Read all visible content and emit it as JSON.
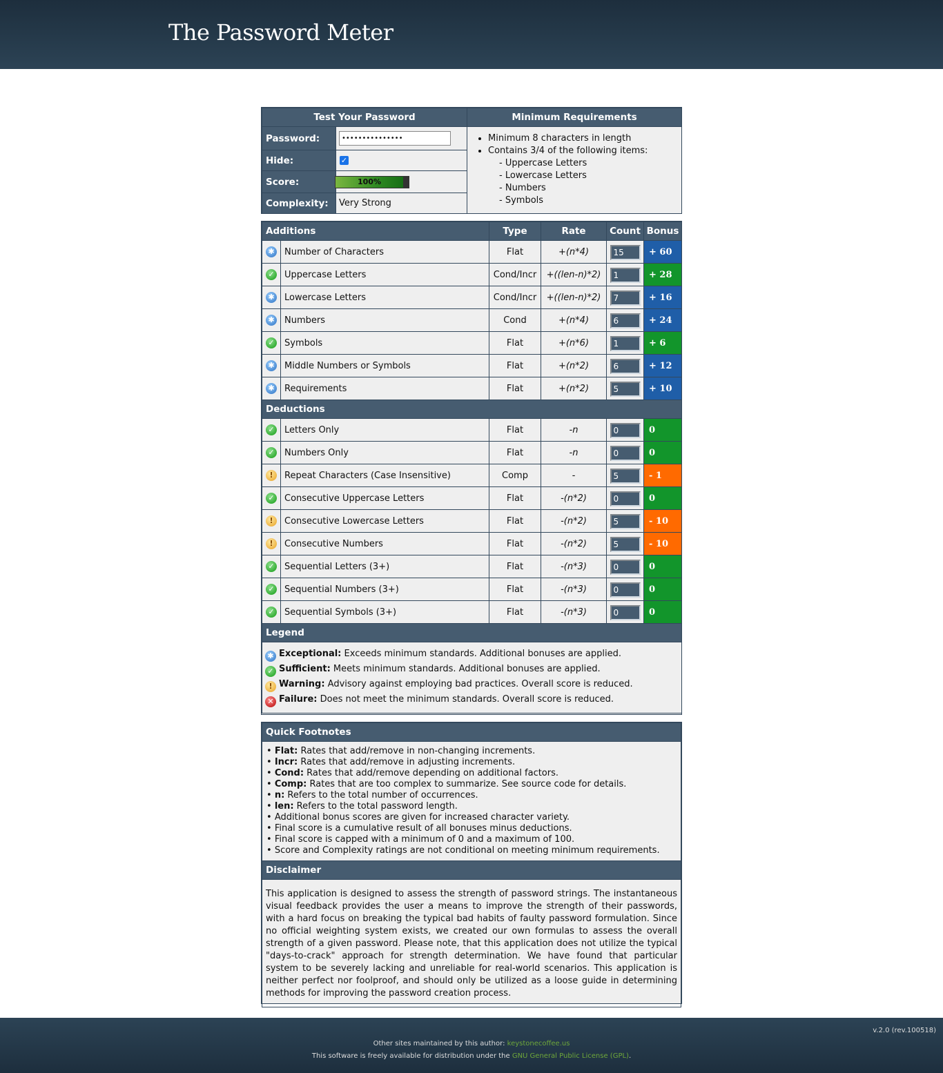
{
  "header": {
    "title": "The Password Meter"
  },
  "test": {
    "title": "Test Your Password",
    "password_label": "Password:",
    "password_value": "•••••••••••••••",
    "hide_label": "Hide:",
    "hide_checked": true,
    "score_label": "Score:",
    "score_text": "100%",
    "score_fraction": 1.0,
    "complexity_label": "Complexity:",
    "complexity_value": "Very Strong"
  },
  "requirements": {
    "title": "Minimum Requirements",
    "items": [
      "Minimum 8 characters in length",
      "Contains 3/4 of the following items:"
    ],
    "subitems": [
      "- Uppercase Letters",
      "- Lowercase Letters",
      "- Numbers",
      "- Symbols"
    ]
  },
  "columns": {
    "additions": "Additions",
    "type": "Type",
    "rate": "Rate",
    "count": "Count",
    "bonus": "Bonus"
  },
  "additions": [
    {
      "status": "exceptional",
      "name": "Number of Characters",
      "type": "Flat",
      "rate": "+(n*4)",
      "count": "15",
      "bonus": "+ 60"
    },
    {
      "status": "sufficient",
      "name": "Uppercase Letters",
      "type": "Cond/Incr",
      "rate": "+((len-n)*2)",
      "count": "1",
      "bonus": "+ 28"
    },
    {
      "status": "exceptional",
      "name": "Lowercase Letters",
      "type": "Cond/Incr",
      "rate": "+((len-n)*2)",
      "count": "7",
      "bonus": "+ 16"
    },
    {
      "status": "exceptional",
      "name": "Numbers",
      "type": "Cond",
      "rate": "+(n*4)",
      "count": "6",
      "bonus": "+ 24"
    },
    {
      "status": "sufficient",
      "name": "Symbols",
      "type": "Flat",
      "rate": "+(n*6)",
      "count": "1",
      "bonus": "+ 6"
    },
    {
      "status": "exceptional",
      "name": "Middle Numbers or Symbols",
      "type": "Flat",
      "rate": "+(n*2)",
      "count": "6",
      "bonus": "+ 12"
    },
    {
      "status": "exceptional",
      "name": "Requirements",
      "type": "Flat",
      "rate": "+(n*2)",
      "count": "5",
      "bonus": "+ 10"
    }
  ],
  "deductions_title": "Deductions",
  "deductions": [
    {
      "status": "sufficient",
      "name": "Letters Only",
      "type": "Flat",
      "rate": "-n",
      "count": "0",
      "bonus": "0"
    },
    {
      "status": "sufficient",
      "name": "Numbers Only",
      "type": "Flat",
      "rate": "-n",
      "count": "0",
      "bonus": "0"
    },
    {
      "status": "warning",
      "name": "Repeat Characters (Case Insensitive)",
      "type": "Comp",
      "rate": "-",
      "count": "5",
      "bonus": "- 1"
    },
    {
      "status": "sufficient",
      "name": "Consecutive Uppercase Letters",
      "type": "Flat",
      "rate": "-(n*2)",
      "count": "0",
      "bonus": "0"
    },
    {
      "status": "warning",
      "name": "Consecutive Lowercase Letters",
      "type": "Flat",
      "rate": "-(n*2)",
      "count": "5",
      "bonus": "- 10"
    },
    {
      "status": "warning",
      "name": "Consecutive Numbers",
      "type": "Flat",
      "rate": "-(n*2)",
      "count": "5",
      "bonus": "- 10"
    },
    {
      "status": "sufficient",
      "name": "Sequential Letters (3+)",
      "type": "Flat",
      "rate": "-(n*3)",
      "count": "0",
      "bonus": "0"
    },
    {
      "status": "sufficient",
      "name": "Sequential Numbers (3+)",
      "type": "Flat",
      "rate": "-(n*3)",
      "count": "0",
      "bonus": "0"
    },
    {
      "status": "sufficient",
      "name": "Sequential Symbols (3+)",
      "type": "Flat",
      "rate": "-(n*3)",
      "count": "0",
      "bonus": "0"
    }
  ],
  "legend": {
    "title": "Legend",
    "items": [
      {
        "status": "exceptional",
        "term": "Exceptional:",
        "text": " Exceeds minimum standards. Additional bonuses are applied."
      },
      {
        "status": "sufficient",
        "term": "Sufficient:",
        "text": " Meets minimum standards. Additional bonuses are applied."
      },
      {
        "status": "warning",
        "term": "Warning:",
        "text": " Advisory against employing bad practices. Overall score is reduced."
      },
      {
        "status": "failure",
        "term": "Failure:",
        "text": " Does not meet the minimum standards. Overall score is reduced."
      }
    ]
  },
  "footnotes": {
    "title": "Quick Footnotes",
    "items": [
      {
        "term": "Flat:",
        "text": " Rates that add/remove in non-changing increments."
      },
      {
        "term": "Incr:",
        "text": " Rates that add/remove in adjusting increments."
      },
      {
        "term": "Cond:",
        "text": " Rates that add/remove depending on additional factors."
      },
      {
        "term": "Comp:",
        "text": " Rates that are too complex to summarize. See source code for details."
      },
      {
        "term": "n:",
        "text": " Refers to the total number of occurrences."
      },
      {
        "term": "len:",
        "text": " Refers to the total password length."
      },
      {
        "term": "",
        "text": "Additional bonus scores are given for increased character variety."
      },
      {
        "term": "",
        "text": "Final score is a cumulative result of all bonuses minus deductions."
      },
      {
        "term": "",
        "text": "Final score is capped with a minimum of 0 and a maximum of 100."
      },
      {
        "term": "",
        "text": "Score and Complexity ratings are not conditional on meeting minimum requirements."
      }
    ]
  },
  "disclaimer": {
    "title": "Disclaimer",
    "text": "This application is designed to assess the strength of password strings. The instantaneous visual feedback provides the user a means to improve the strength of their passwords, with a hard focus on breaking the typical bad habits of faulty password formulation. Since no official weighting system exists, we created our own formulas to assess the overall strength of a given password. Please note, that this application does not utilize the typical \"days-to-crack\" approach for strength determination. We have found that particular system to be severely lacking and unreliable for real-world scenarios. This application is neither perfect nor foolproof, and should only be utilized as a loose guide in determining methods for improving the password creation process."
  },
  "footer": {
    "version": "v.2.0 (rev.100518)",
    "line1_prefix": "Other sites maintained by this author: ",
    "line1_link": "keystonecoffee.us",
    "line2_prefix": "This software is freely available for distribution under the ",
    "line2_link": "GNU General Public License (GPL)",
    "line2_suffix": "."
  },
  "colors": {
    "header_bg": "#1d2e3d",
    "table_header": "#465c70",
    "exceptional": "#1f5ea8",
    "sufficient": "#12952b",
    "warning": "#ff6a00",
    "failure": "#b40000"
  },
  "icons": {
    "exceptional": "exceptional-icon",
    "sufficient": "sufficient-icon",
    "warning": "warning-icon",
    "failure": "failure-icon"
  }
}
